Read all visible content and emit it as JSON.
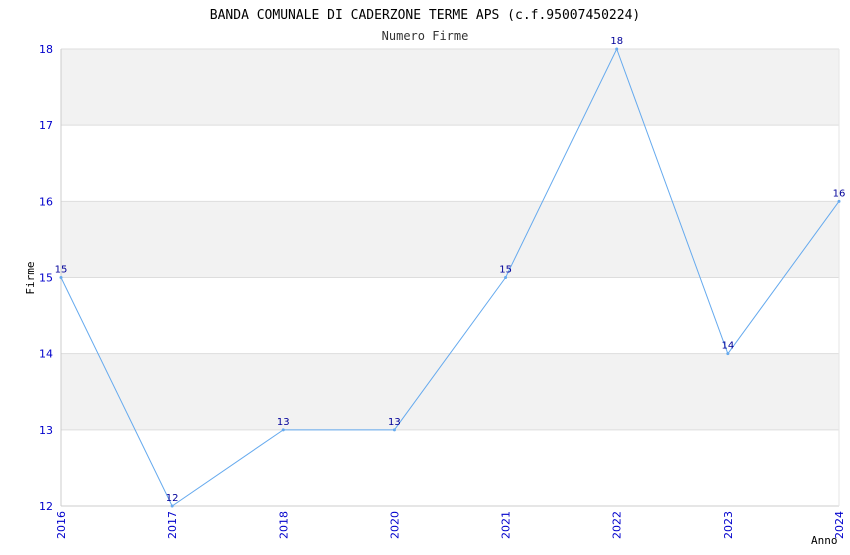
{
  "chart_data": {
    "type": "line",
    "title": "BANDA COMUNALE DI CADERZONE TERME APS (c.f.95007450224)",
    "subtitle": "Numero Firme",
    "xlabel": "Anno",
    "ylabel": "Firme",
    "x": [
      "2016",
      "2017",
      "2018",
      "2020",
      "2021",
      "2022",
      "2023",
      "2024"
    ],
    "series": [
      {
        "values": [
          15,
          12,
          13,
          13,
          15,
          18,
          14,
          16
        ]
      }
    ],
    "ylim": [
      12,
      18
    ],
    "yticks": [
      "12",
      "13",
      "14",
      "15",
      "16",
      "17",
      "18"
    ],
    "grid": true,
    "line_color": "#66aaee",
    "band_color": "#f2f2f2"
  }
}
